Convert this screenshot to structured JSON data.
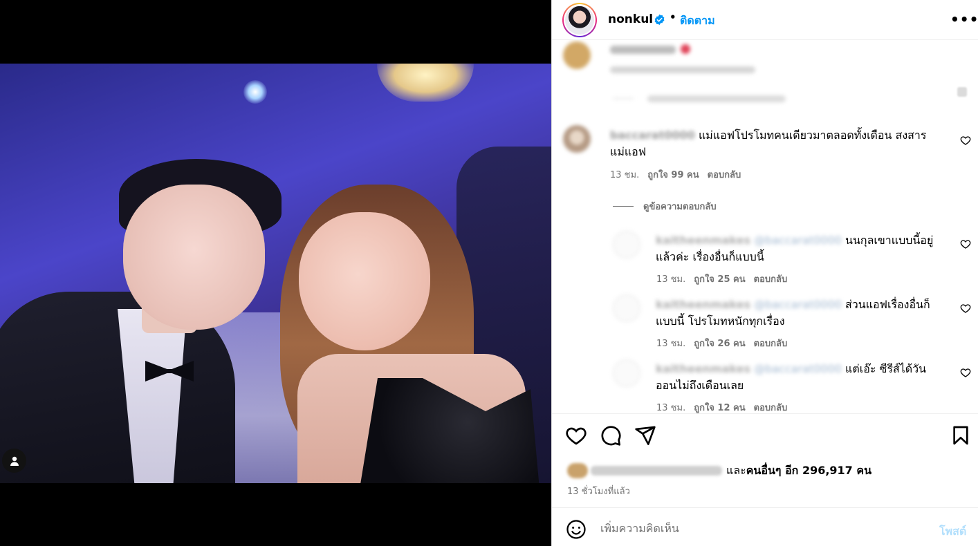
{
  "post": {
    "username": "nonkul",
    "follow_label": "ติดตาม",
    "more_label": "•••",
    "separator": "•"
  },
  "comments": [
    {
      "username": "baccarat0000",
      "text": "แม่แอฟโปรโมทคนเดียวมาตลอดทั้งเดือน สงสารแม่แอฟ",
      "time": "13 ชม.",
      "likes": "ถูกใจ 99 คน",
      "reply_label": "ตอบกลับ"
    }
  ],
  "view_replies_label": "ดูข้อความตอบกลับ",
  "replies": [
    {
      "username": "kaitheenmakes",
      "mention": "@baccarat0000",
      "text": "นนกุลเขาแบบนี้อยู่แล้วค่ะ เรื่องอื่นก็แบบนี้",
      "time": "13 ชม.",
      "likes": "ถูกใจ 25 คน",
      "reply_label": "ตอบกลับ"
    },
    {
      "username": "kaitheenmakes",
      "mention": "@baccarat0000",
      "text": "ส่วนแอฟเรื่องอื่นก็แบบนี้ โปรโมทหนักทุกเรื่อง",
      "time": "13 ชม.",
      "likes": "ถูกใจ 26 คน",
      "reply_label": "ตอบกลับ"
    },
    {
      "username": "kaitheenmakes",
      "mention": "@baccarat0000",
      "text": "แต่เอ๊ะ ซีรีส์ได้วันออนไม่ถึงเดือนเลย",
      "time": "13 ชม.",
      "likes": "ถูกใจ 12 คน",
      "reply_label": "ตอบกลับ"
    }
  ],
  "likes_summary": {
    "prefix": "และ",
    "others": "คนอื่นๆ อีก 296,917 คน"
  },
  "posted_time": "13 ชั่วโมงที่แล้ว",
  "composer": {
    "placeholder": "เพิ่มความคิดเห็น",
    "post_label": "โพสต์"
  },
  "colors": {
    "accent": "#0095f6",
    "post_disabled": "#b2dffc",
    "muted": "#737373"
  },
  "icons": [
    "verified-badge-icon",
    "more-options-icon",
    "heart-icon",
    "comment-icon",
    "share-icon",
    "bookmark-icon",
    "emoji-icon",
    "user-tag-icon"
  ]
}
